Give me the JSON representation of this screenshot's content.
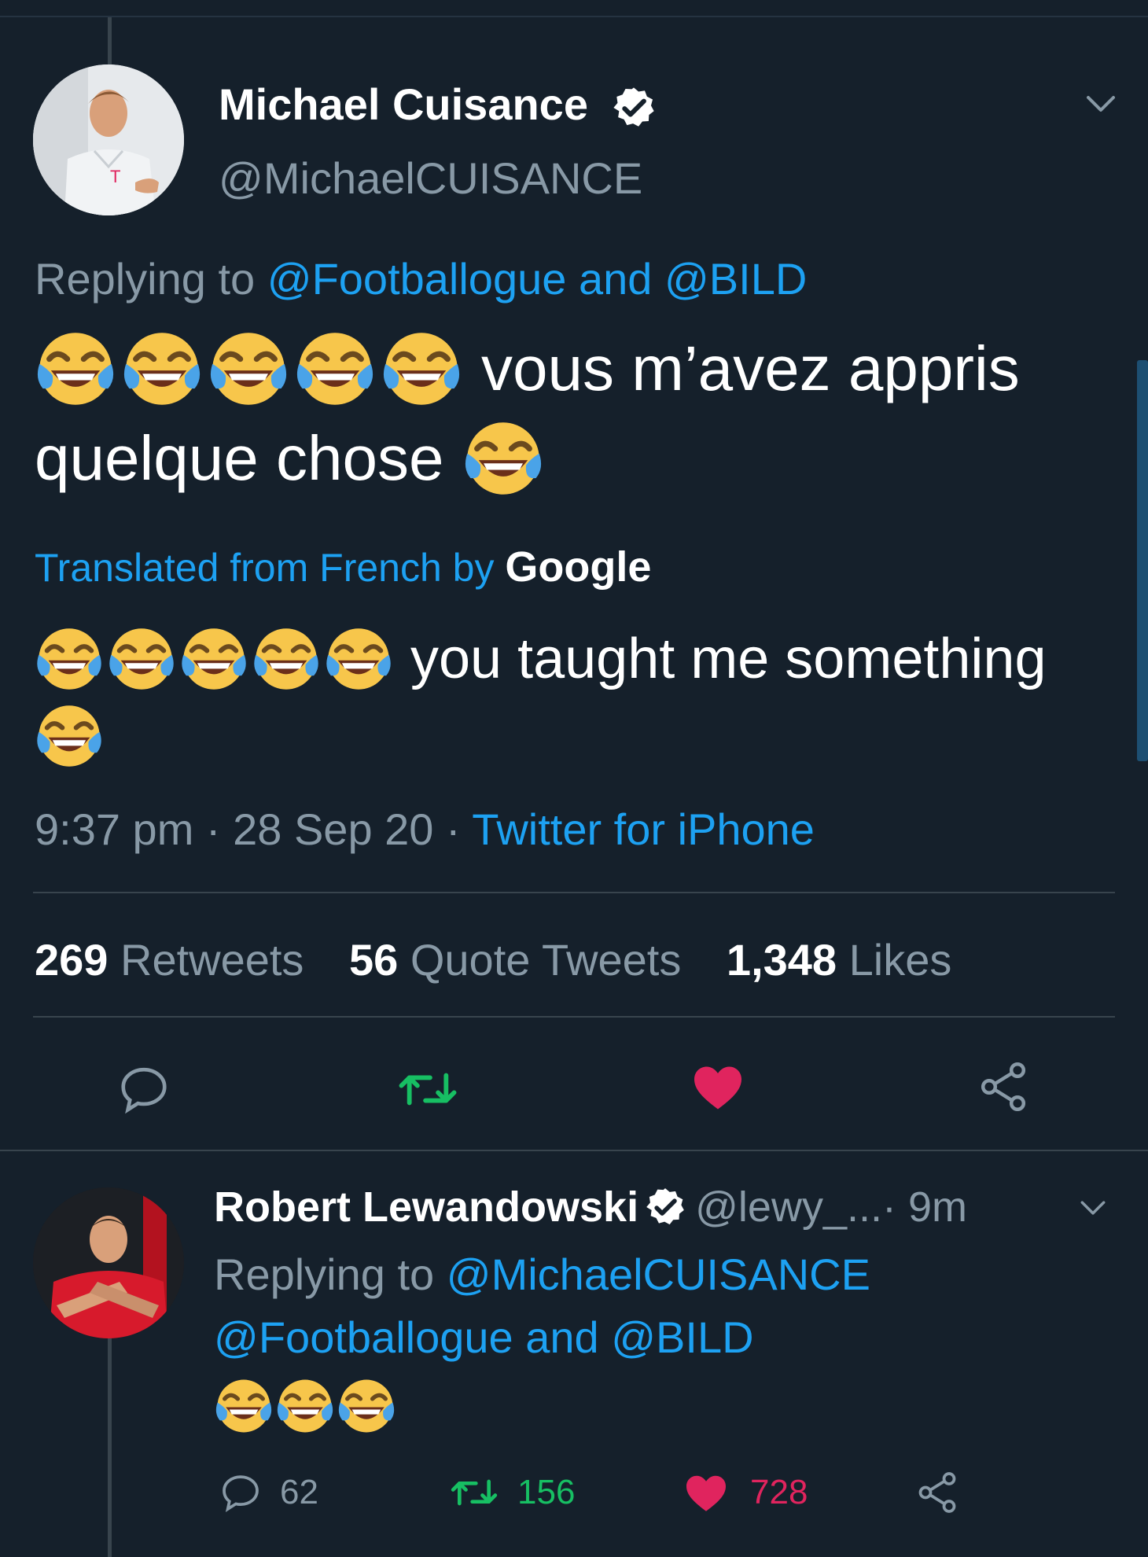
{
  "tweet": {
    "author_name": "Michael Cuisance",
    "author_handle": "@MichaelCUISANCE",
    "replying_prefix": "Replying to ",
    "replying_to": "@Footballogue and @BILD",
    "text_line1": "vous m’avez appris",
    "text_line2": "quelque chose",
    "translated_label": "Translated from French by ",
    "translated_brand": "Google",
    "translated_text": "you taught me something",
    "time": "9:37 pm · 28 Sep 20 · ",
    "source": "Twitter for iPhone",
    "stats": {
      "retweets_count": "269",
      "retweets_label": " Retweets",
      "quotes_count": "56",
      "quotes_label": " Quote Tweets",
      "likes_count": "1,348",
      "likes_label": " Likes"
    }
  },
  "reply": {
    "author_name": "Robert Lewandowski",
    "author_handle": "@lewy_...",
    "time": " · 9m",
    "replying_prefix": "Replying to ",
    "replying_to_line1": "@MichaelCUISANCE",
    "replying_to_line2": "@Footballogue and @BILD",
    "replies": "62",
    "retweets": "156",
    "likes": "728"
  },
  "icons": {
    "emoji": "face-with-tears-of-joy",
    "verified": "verified-badge-icon",
    "chevron": "chevron-down-icon",
    "reply": "reply-icon",
    "retweet": "retweet-icon",
    "like": "heart-icon",
    "share": "share-icon"
  },
  "colors": {
    "background": "#15202b",
    "link": "#1da1f2",
    "muted": "#8899a6",
    "retweet": "#17bf63",
    "like": "#e0245e"
  }
}
